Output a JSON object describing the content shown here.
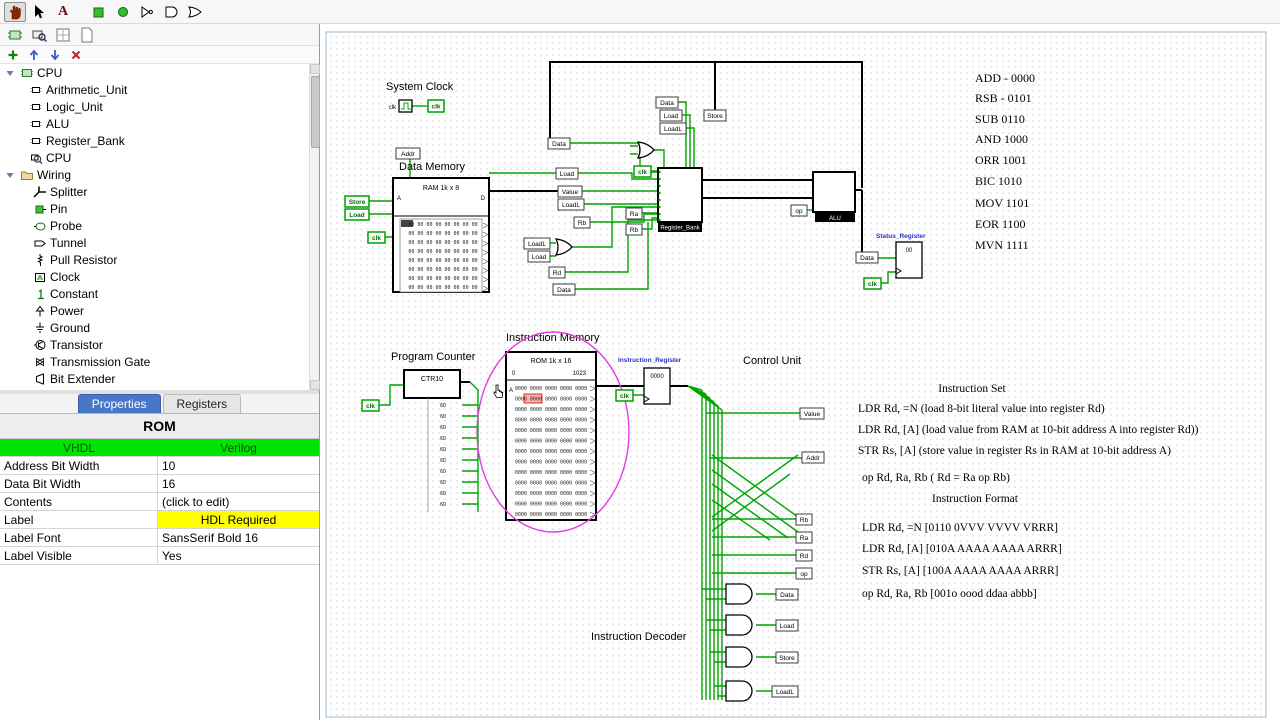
{
  "toolbar": {
    "text_tool_glyph": "A"
  },
  "explorer": {
    "root_label": "CPU",
    "circuits": [
      "Arithmetic_Unit",
      "Logic_Unit",
      "ALU",
      "Register_Bank",
      "CPU"
    ],
    "wiring_label": "Wiring",
    "wiring_items": [
      "Splitter",
      "Pin",
      "Probe",
      "Tunnel",
      "Pull Resistor",
      "Clock",
      "Constant",
      "Power",
      "Ground",
      "Transistor",
      "Transmission Gate",
      "Bit Extender"
    ]
  },
  "properties": {
    "tab_properties": "Properties",
    "tab_registers": "Registers",
    "title": "ROM",
    "hdl_vhdl": "VHDL",
    "hdl_verilog": "Verilog",
    "rows": [
      {
        "label": "Address Bit Width",
        "value": "10"
      },
      {
        "label": "Data Bit Width",
        "value": "16"
      },
      {
        "label": "Contents",
        "value": "(click to edit)"
      },
      {
        "label": "Label",
        "value": "HDL Required"
      },
      {
        "label": "Label Font",
        "value": "SansSerif Bold 16"
      },
      {
        "label": "Label Visible",
        "value": "Yes"
      }
    ]
  },
  "canvas": {
    "labels": {
      "system_clock": "System Clock",
      "data_memory": "Data Memory",
      "program_counter": "Program Counter",
      "instruction_memory": "Instruction Memory",
      "control_unit": "Control Unit",
      "instruction_decoder": "Instruction Decoder",
      "register_bank": "Register_Bank",
      "alu": "ALU",
      "status_register": "Status_Register",
      "instruction_register": "Instruction_Register"
    },
    "components": {
      "ram_title": "RAM 1k x 8",
      "rom_title": "ROM 1k x 16",
      "counter_title": "CTR10",
      "rom_addr_low": "0",
      "rom_addr_high": "1023",
      "ram_row": "00 00 00 00 00 00 00 00",
      "rom_row": "0000 0000 0000 0000 0000",
      "pc_bit_row": "6D",
      "ir_value": "0000",
      "reg_value": "00",
      "port_a": "A",
      "port_d": "D"
    },
    "tunnels": {
      "data": "Data",
      "load": "Load",
      "loadl": "LoadL",
      "value": "Value",
      "store": "Store",
      "addr": "Addr",
      "clk": "clk",
      "ra": "Ra",
      "rb": "Rb",
      "rd": "Rd",
      "op": "op"
    },
    "opcodes": [
      "ADD - 0000",
      "RSB - 0101",
      "SUB 0110",
      "AND 1000",
      "ORR 1001",
      "BIC 1010",
      "MOV 1101",
      "EOR 1100",
      "MVN 1111"
    ],
    "instruction_set_title": "Instruction Set",
    "instruction_set": [
      "LDR Rd, =N (load 8-bit literal value into register Rd)",
      "LDR Rd, [A] (load value from RAM at 10-bit address A into register Rd))",
      "STR Rs, [A] (store value in register Rs in RAM at 10-bit address A)",
      "op Rd, Ra, Rb ( Rd = Ra op Rb)"
    ],
    "instruction_format_title": "Instruction Format",
    "instruction_format": [
      "LDR Rd, =N [0110 0VVV VVVV VRRR]",
      "LDR Rd, [A] [010A AAAA AAAA ARRR]",
      "STR Rs, [A] [100A AAAA AAAA ARRR]",
      "op Rd, Ra, Rb [001o oood ddaa abbb]"
    ]
  }
}
